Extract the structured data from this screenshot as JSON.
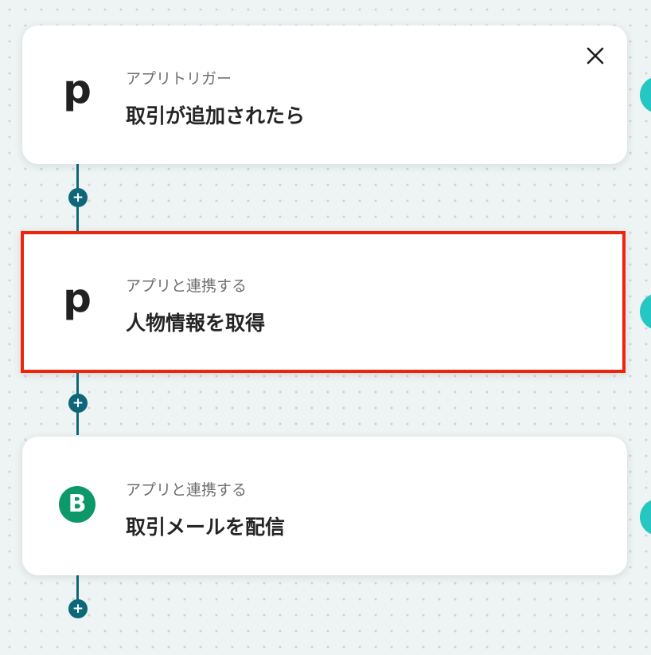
{
  "flow": {
    "steps": [
      {
        "app": "pipedrive",
        "icon_glyph": "p",
        "icon_name": "pipedrive-icon",
        "type_label": "アプリトリガー",
        "title": "取引が追加されたら",
        "selected": false
      },
      {
        "app": "pipedrive",
        "icon_glyph": "p",
        "icon_name": "pipedrive-icon",
        "type_label": "アプリと連携する",
        "title": "人物情報を取得",
        "selected": true
      },
      {
        "app": "brevo",
        "icon_glyph": "B",
        "icon_name": "brevo-icon",
        "type_label": "アプリと連携する",
        "title": "取引メールを配信",
        "selected": false
      }
    ],
    "add_step_glyph": "+",
    "close_icon": "close-icon"
  },
  "colors": {
    "connector": "#0d6779",
    "highlight_border": "#f2230c",
    "brevo_green": "#0c9868",
    "side_dot": "#25c7c2",
    "canvas_bg": "#eef3f3"
  }
}
